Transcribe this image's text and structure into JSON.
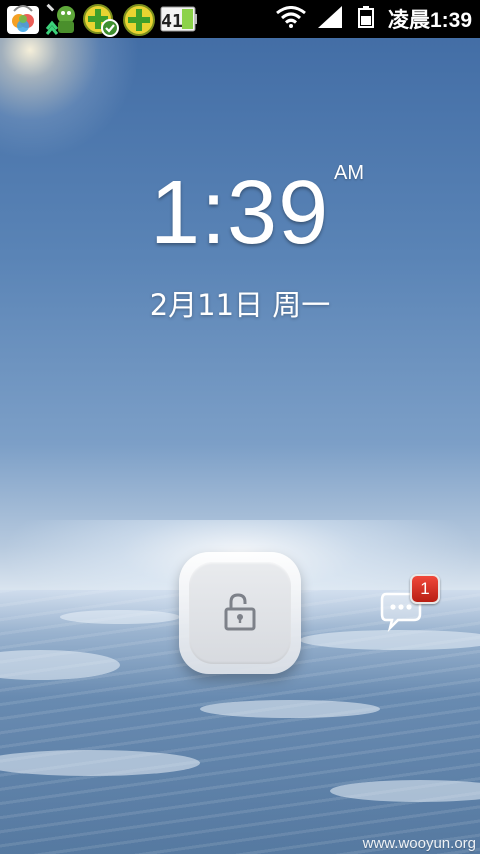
{
  "status_bar": {
    "notification_icons": [
      "store-app-icon",
      "game-assistant-icon",
      "360-security-update-icon",
      "360-security-icon",
      "battery-widget-icon"
    ],
    "battery_widget_text": "41",
    "signal_icons": [
      "wifi-icon",
      "cell-signal-icon",
      "battery-icon"
    ],
    "time": "凌晨1:39"
  },
  "lock_screen": {
    "clock_time": "1:39",
    "clock_ampm": "AM",
    "date": "2月11日 周一",
    "unlock_icon": "padlock-open-icon",
    "message_icon": "chat-bubble-icon",
    "unread_messages": "1"
  },
  "watermark": "www.wooyun.org",
  "colors": {
    "status_bar_bg": "#000000",
    "badge_red": "#d92c1f"
  }
}
